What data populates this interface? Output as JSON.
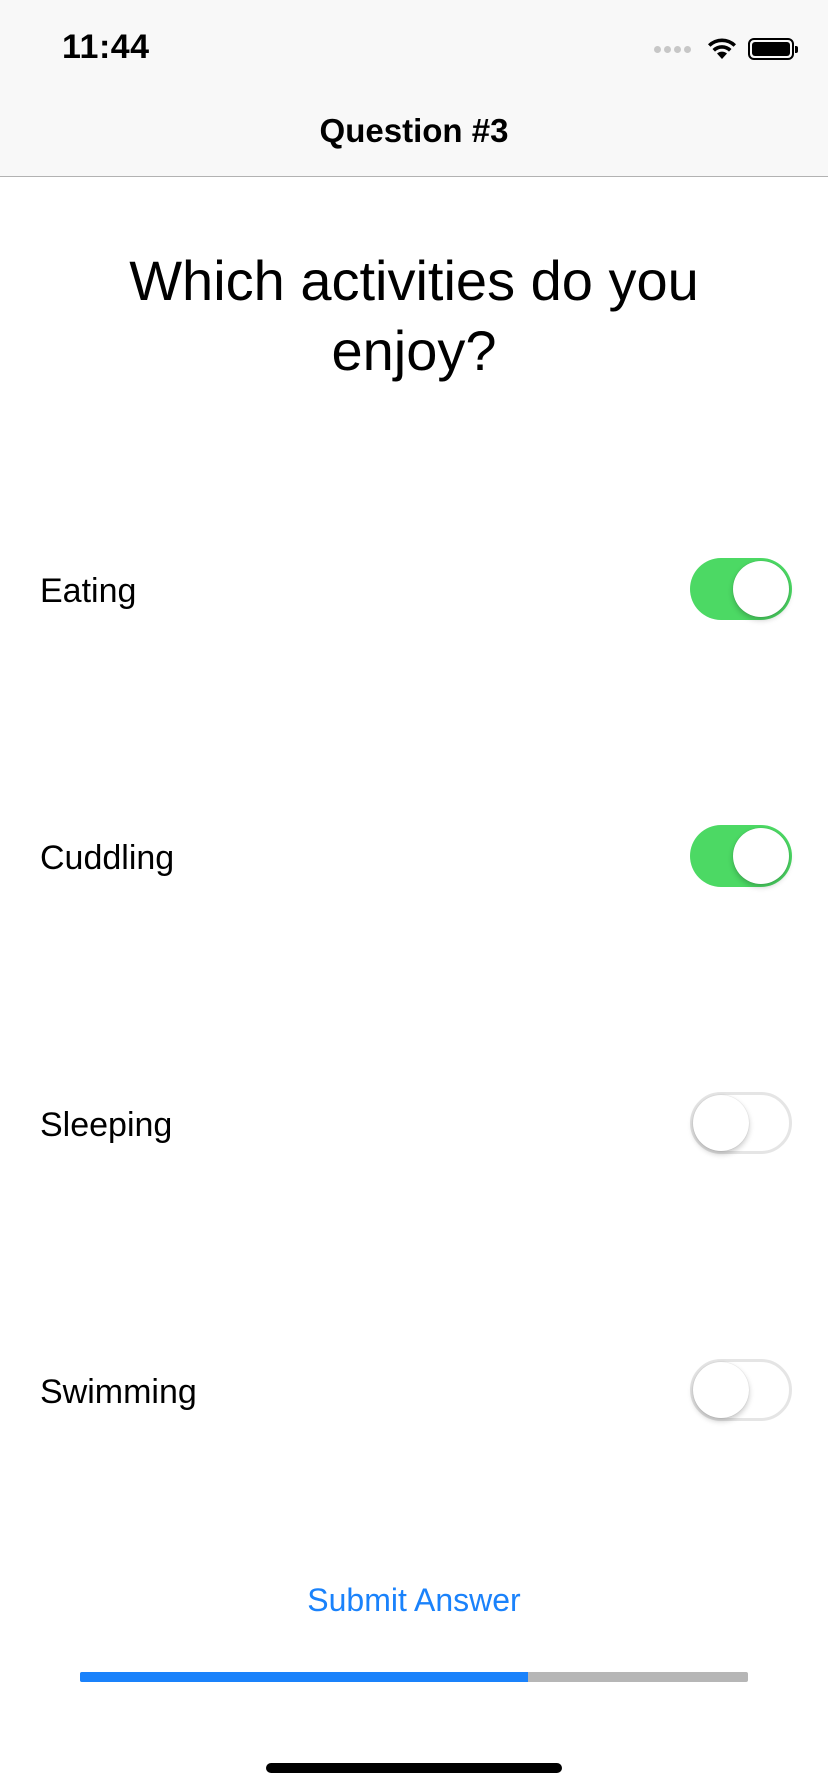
{
  "status_bar": {
    "time": "11:44"
  },
  "nav": {
    "title": "Question #3"
  },
  "question": {
    "text": "Which activities do you enjoy?"
  },
  "options": [
    {
      "label": "Eating",
      "enabled": true
    },
    {
      "label": "Cuddling",
      "enabled": true
    },
    {
      "label": "Sleeping",
      "enabled": false
    },
    {
      "label": "Swimming",
      "enabled": false
    }
  ],
  "submit": {
    "label": "Submit Answer"
  },
  "progress": {
    "fraction": 0.67
  },
  "colors": {
    "accent": "#1a82fb",
    "switch_on": "#4cd964",
    "track": "#b6b6b6"
  },
  "icons": {
    "signal": "cellular-signal-icon",
    "wifi": "wifi-icon",
    "battery": "battery-icon"
  }
}
